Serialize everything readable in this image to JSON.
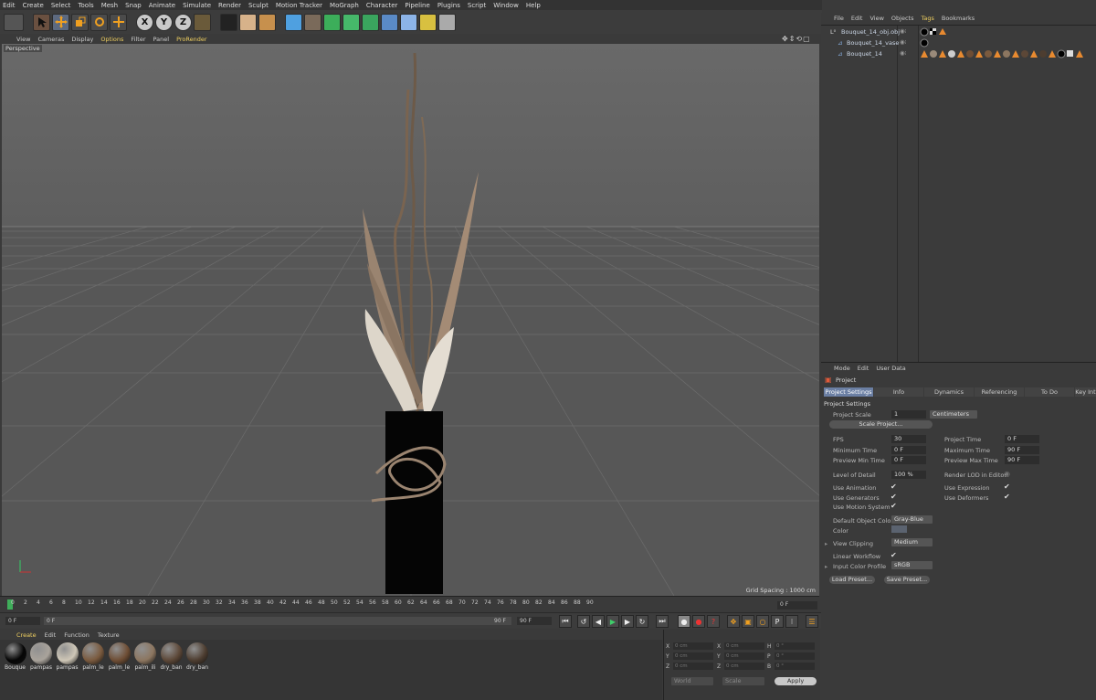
{
  "menubar": [
    "Edit",
    "Create",
    "Select",
    "Tools",
    "Mesh",
    "Snap",
    "Animate",
    "Simulate",
    "Render",
    "Sculpt",
    "Motion Tracker",
    "MoGraph",
    "Character",
    "Pipeline",
    "Plugins",
    "Script",
    "Window",
    "Help"
  ],
  "viewport": {
    "menu": [
      "View",
      "Cameras",
      "Display",
      "Options",
      "Filter",
      "Panel",
      "ProRender"
    ],
    "camera_label": "Perspective",
    "grid_spacing": "Grid Spacing : 1000 cm"
  },
  "timeline": {
    "ticks": [
      "0",
      "2",
      "4",
      "6",
      "8",
      "10",
      "12",
      "14",
      "16",
      "18",
      "20",
      "22",
      "24",
      "26",
      "28",
      "30",
      "32",
      "34",
      "36",
      "38",
      "40",
      "42",
      "44",
      "46",
      "48",
      "50",
      "52",
      "54",
      "56",
      "58",
      "60",
      "62",
      "64",
      "66",
      "68",
      "70",
      "72",
      "74",
      "76",
      "78",
      "80",
      "82",
      "84",
      "86",
      "88",
      "90"
    ],
    "end_field": "0 F",
    "start_field": "0 F",
    "range_start": "0 F",
    "range_end": "90 F",
    "max_field": "90 F"
  },
  "materials": {
    "menu": [
      "Create",
      "Edit",
      "Function",
      "Texture"
    ],
    "items": [
      {
        "label": "Bouque",
        "color": "#050505"
      },
      {
        "label": "pampas",
        "color": "#a9a39b"
      },
      {
        "label": "pampas",
        "color": "#cfc7b7"
      },
      {
        "label": "palm_le",
        "color": "#7a5a3e"
      },
      {
        "label": "palm_le",
        "color": "#6e4d34"
      },
      {
        "label": "palm_ili",
        "color": "#8c7660"
      },
      {
        "label": "dry_ban",
        "color": "#5c4737"
      },
      {
        "label": "dry_ban",
        "color": "#4d3d30"
      }
    ]
  },
  "coords": {
    "rows": [
      {
        "a": "X",
        "av": "0 cm",
        "b": "X",
        "bv": "0 cm",
        "c": "H",
        "cv": "0 °"
      },
      {
        "a": "Y",
        "av": "0 cm",
        "b": "Y",
        "bv": "0 cm",
        "c": "P",
        "cv": "0 °"
      },
      {
        "a": "Z",
        "av": "0 cm",
        "b": "Z",
        "bv": "0 cm",
        "c": "B",
        "cv": "0 °"
      }
    ],
    "mode1": "World",
    "mode2": "Scale",
    "apply": "Apply"
  },
  "object_manager": {
    "menu": [
      "File",
      "Edit",
      "View",
      "Objects",
      "Tags",
      "Bookmarks"
    ],
    "objects": [
      "Bouquet_14_obj.obj",
      "Bouquet_14_vase",
      "Bouquet_14"
    ]
  },
  "attributes": {
    "menu": [
      "Mode",
      "Edit",
      "User Data"
    ],
    "title": "Project",
    "tabs": [
      "Project Settings",
      "Info",
      "Dynamics",
      "Referencing",
      "To Do",
      "Key Int"
    ],
    "section": "Project Settings",
    "project_scale_label": "Project Scale",
    "project_scale_value": "1",
    "project_scale_unit": "Centimeters",
    "scale_project_btn": "Scale Project...",
    "fps_label": "FPS",
    "fps": "30",
    "project_time_label": "Project Time",
    "project_time": "0 F",
    "min_time_label": "Minimum Time",
    "min_time": "0 F",
    "max_time_label": "Maximum Time",
    "max_time": "90 F",
    "prev_min_label": "Preview Min Time",
    "prev_min": "0 F",
    "prev_max_label": "Preview Max Time",
    "prev_max": "90 F",
    "lod_label": "Level of Detail",
    "lod": "100 %",
    "render_lod_label": "Render LOD in Editor",
    "use_animation": "Use Animation",
    "use_expression": "Use Expression",
    "use_generators": "Use Generators",
    "use_deformers": "Use Deformers",
    "use_motion": "Use Motion System",
    "default_color_label": "Default Object Color",
    "default_color": "Gray-Blue",
    "color_label": "Color",
    "view_clipping_label": "View Clipping",
    "view_clipping": "Medium",
    "linear_label": "Linear Workflow",
    "input_color_label": "Input Color Profile",
    "input_color": "sRGB",
    "load_preset": "Load Preset...",
    "save_preset": "Save Preset..."
  }
}
